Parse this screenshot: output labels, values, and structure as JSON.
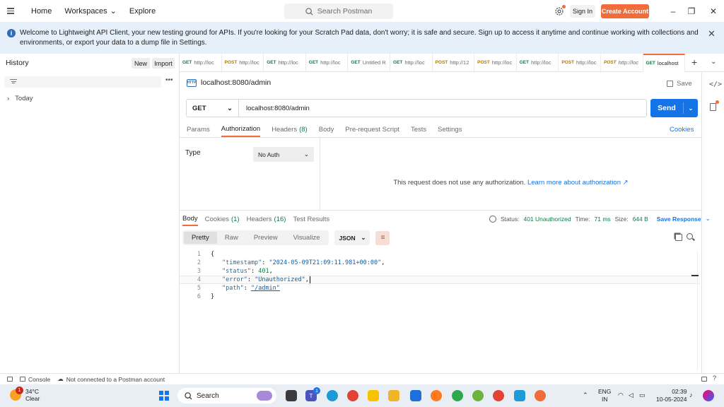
{
  "topbar": {
    "home": "Home",
    "workspaces": "Workspaces",
    "explore": "Explore",
    "search_placeholder": "Search Postman",
    "sign_in": "Sign In",
    "create_account": "Create Account"
  },
  "banner": {
    "text": "Welcome to Lightweight API Client, your new testing ground for APIs. If you're looking for your Scratch Pad data, don't worry; it is safe and secure. Sign up to access it anytime and continue working with collections and environments, or export your data to a dump file in Settings."
  },
  "sidebar": {
    "title": "History",
    "new_label": "New",
    "import_label": "Import",
    "groups": [
      "Today"
    ]
  },
  "tabs": [
    {
      "method": "GET",
      "label": "http://loc"
    },
    {
      "method": "POST",
      "label": "http://loc"
    },
    {
      "method": "GET",
      "label": "http://loc"
    },
    {
      "method": "GET",
      "label": "http://loc"
    },
    {
      "method": "GET",
      "label": "Untitled R"
    },
    {
      "method": "GET",
      "label": "http://loc"
    },
    {
      "method": "POST",
      "label": "http://12"
    },
    {
      "method": "POST",
      "label": "http://loc"
    },
    {
      "method": "GET",
      "label": "http://loc"
    },
    {
      "method": "POST",
      "label": "http://loc"
    },
    {
      "method": "POST",
      "label": "http://loc"
    },
    {
      "method": "GET",
      "label": "localhost"
    }
  ],
  "request": {
    "title": "localhost:8080/admin",
    "save_label": "Save",
    "method": "GET",
    "url": "localhost:8080/admin",
    "send_label": "Send",
    "tabs": {
      "params": "Params",
      "authorization": "Authorization",
      "headers": "Headers",
      "headers_count": "(8)",
      "body": "Body",
      "prerequest": "Pre-request Script",
      "tests": "Tests",
      "settings": "Settings"
    },
    "cookies_link": "Cookies",
    "auth": {
      "type_label": "Type",
      "type_value": "No Auth",
      "message": "This request does not use any authorization.",
      "learn_more": "Learn more about authorization ↗"
    }
  },
  "response": {
    "tabs": {
      "body": "Body",
      "cookies": "Cookies",
      "cookies_count": "(1)",
      "headers": "Headers",
      "headers_count": "(16)",
      "test_results": "Test Results"
    },
    "status_label": "Status:",
    "status_value": "401 Unauthorized",
    "time_label": "Time:",
    "time_value": "71 ms",
    "size_label": "Size:",
    "size_value": "644 B",
    "save_response": "Save Response",
    "formats": [
      "Pretty",
      "Raw",
      "Preview",
      "Visualize"
    ],
    "language": "JSON",
    "lines": [
      {
        "n": "1",
        "text": "{"
      },
      {
        "n": "2",
        "key": "\"timestamp\"",
        "value": "\"2024-05-09T21:09:11.981+00:00\"",
        "tail": ","
      },
      {
        "n": "3",
        "key": "\"status\"",
        "value": "401",
        "tail": ","
      },
      {
        "n": "4",
        "key": "\"error\"",
        "value": "\"Unauthorized\"",
        "tail": ","
      },
      {
        "n": "5",
        "key": "\"path\"",
        "value": "\"/admin\"",
        "tail": ""
      },
      {
        "n": "6",
        "text": "}"
      }
    ]
  },
  "statusbar": {
    "console": "Console",
    "connection": "Not connected to a Postman account"
  },
  "taskbar": {
    "temperature": "34°C",
    "weather": "Clear",
    "weather_badge": "1",
    "search": "Search",
    "lang_top": "ENG",
    "lang_bottom": "IN",
    "time": "02:39",
    "date": "10-05-2024"
  }
}
